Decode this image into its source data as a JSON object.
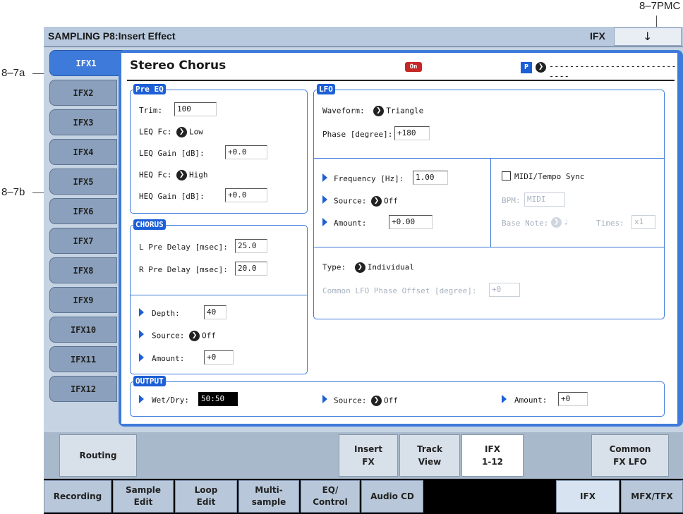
{
  "callouts": {
    "pmc": "8–7PMC",
    "a": "8–7a",
    "b": "8–7b"
  },
  "header": {
    "title": "SAMPLING P8:Insert Effect",
    "page_label": "IFX",
    "menu_icon": "chevron-down-icon"
  },
  "ifx_tabs": [
    "IFX1",
    "IFX2",
    "IFX3",
    "IFX4",
    "IFX5",
    "IFX6",
    "IFX7",
    "IFX8",
    "IFX9",
    "IFX10",
    "IFX11",
    "IFX12"
  ],
  "effect": {
    "name": "Stereo Chorus",
    "on_label": "On",
    "p_label": "P",
    "dashes": "-----------------------------"
  },
  "pre_eq": {
    "label": "Pre EQ",
    "trim_label": "Trim:",
    "trim": "100",
    "leq_fc_label": "LEQ Fc:",
    "leq_fc": "Low",
    "leq_gain_label": "LEQ Gain [dB]:",
    "leq_gain": "+0.0",
    "heq_fc_label": "HEQ Fc:",
    "heq_fc": "High",
    "heq_gain_label": "HEQ Gain [dB]:",
    "heq_gain": "+0.0"
  },
  "chorus": {
    "label": "CHORUS",
    "l_pre_label": "L Pre Delay [msec]:",
    "l_pre": "25.0",
    "r_pre_label": "R Pre Delay [msec]:",
    "r_pre": "20.0",
    "depth_label": "Depth:",
    "depth": "40",
    "source_label": "Source:",
    "source": "Off",
    "amount_label": "Amount:",
    "amount": "+0"
  },
  "lfo": {
    "label": "LFO",
    "waveform_label": "Waveform:",
    "waveform": "Triangle",
    "phase_label": "Phase [degree]:",
    "phase": "+180",
    "freq_label": "Frequency [Hz]:",
    "freq": "1.00",
    "source_label": "Source:",
    "source": "Off",
    "amount_label": "Amount:",
    "amount": "+0.00",
    "midi_sync_label": "MIDI/Tempo Sync",
    "bpm_label": "BPM:",
    "bpm": "MIDI",
    "base_note_label": "Base Note:",
    "base_note": "♩",
    "times_label": "Times:",
    "times": "x1",
    "type_label": "Type:",
    "type": "Individual",
    "common_label": "Common LFO Phase Offset [degree]:",
    "common": "+0"
  },
  "output": {
    "label": "OUTPUT",
    "wetdry_label": "Wet/Dry:",
    "wetdry": "50:50",
    "source_label": "Source:",
    "source": "Off",
    "amount_label": "Amount:",
    "amount": "+0"
  },
  "sub_tabs": {
    "routing": "Routing",
    "insert": "Insert\nFX",
    "track": "Track\nView",
    "ifx": "IFX\n1-12",
    "common": "Common\nFX LFO"
  },
  "mode_tabs": {
    "recording": "Recording",
    "sample_edit": "Sample\nEdit",
    "loop_edit": "Loop\nEdit",
    "multisample": "Multi-\nsample",
    "eq": "EQ/\nControl",
    "audio_cd": "Audio CD",
    "ifx": "IFX",
    "mfx": "MFX/TFX"
  }
}
